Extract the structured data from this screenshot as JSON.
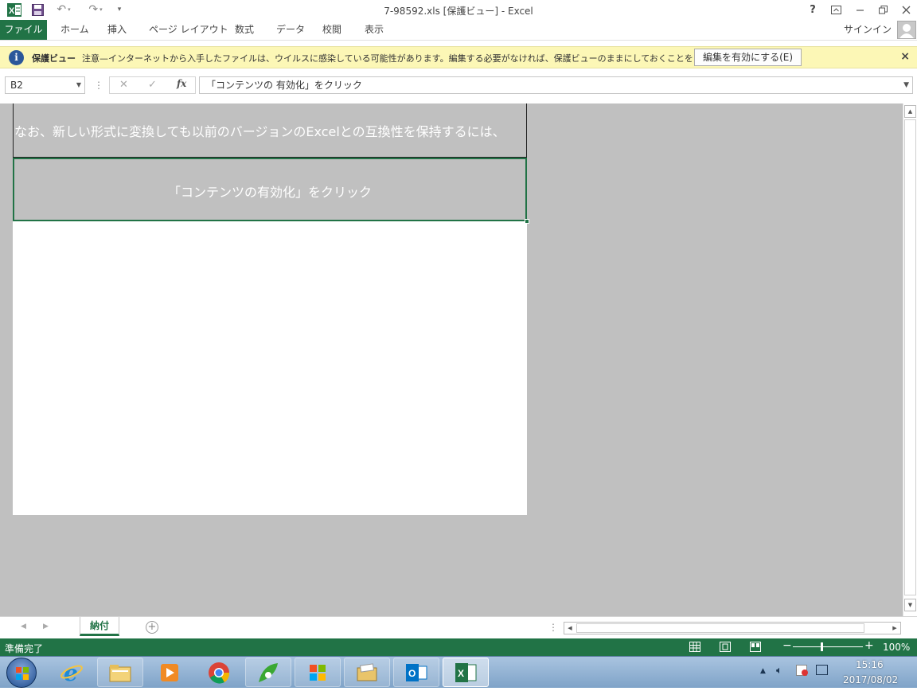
{
  "window": {
    "title": "7-98592.xls  [保護ビュー] - Excel",
    "help": "?",
    "undo_icon": "undo-icon",
    "redo_icon": "redo-icon"
  },
  "ribbon": {
    "tabs": [
      "ファイル",
      "ホーム",
      "挿入",
      "ページ レイアウト",
      "数式",
      "データ",
      "校閲",
      "表示"
    ],
    "signin": "サインイン"
  },
  "message_bar": {
    "title": "保護ビュー",
    "text": "注意—インターネットから入手したファイルは、ウイルスに感染している可能性があります。編集する必要がなければ、保護ビューのままにしておくことをお勧めします。",
    "enable_button": "編集を有効にする(E)",
    "close": "×"
  },
  "formula_bar": {
    "name_box": "B2",
    "fx": "fx",
    "formula": "「コンテンツの 有効化」をクリック"
  },
  "sheet": {
    "row1_text": "なお、新しい形式に変換しても以前のバージョンのExcelとの互換性を保持するには、",
    "row2_text": "「コンテンツの有効化」をクリック",
    "tab": "納付",
    "add_sheet": "+"
  },
  "status_bar": {
    "status": "準備完了",
    "zoom": "100%",
    "zoom_level_fraction": 0.5
  },
  "taskbar": {
    "time": "15:16",
    "date": "2017/08/02"
  },
  "colors": {
    "excel_green": "#217346",
    "message_bar_bg": "#fcf7b6",
    "sheet_gray": "#c0c0c0"
  }
}
